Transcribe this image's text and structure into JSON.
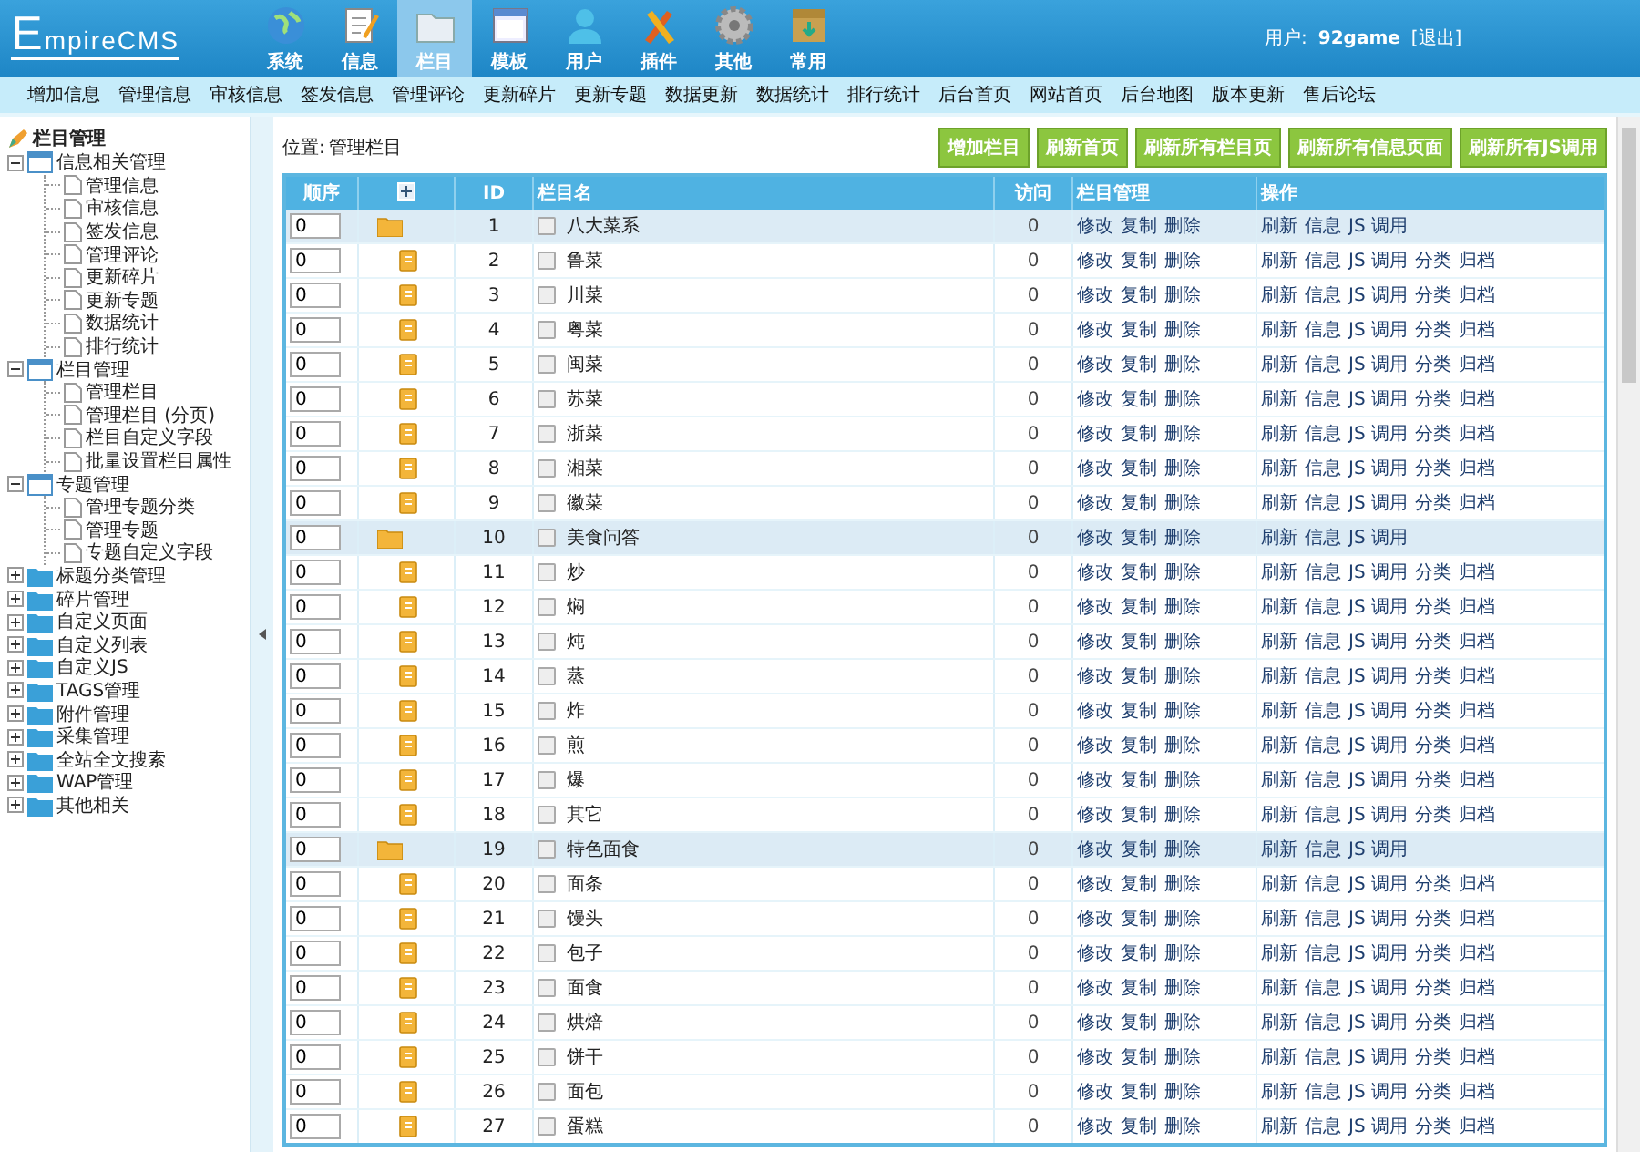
{
  "header": {
    "logo": "EmpireCMS",
    "nav": [
      {
        "label": "系统",
        "selected": false
      },
      {
        "label": "信息",
        "selected": false
      },
      {
        "label": "栏目",
        "selected": true
      },
      {
        "label": "模板",
        "selected": false
      },
      {
        "label": "用户",
        "selected": false
      },
      {
        "label": "插件",
        "selected": false
      },
      {
        "label": "其他",
        "selected": false
      },
      {
        "label": "常用",
        "selected": false
      }
    ],
    "user_label": "用户:",
    "user_name": "92game",
    "logout": "[退出]"
  },
  "menu": [
    "增加信息",
    "管理信息",
    "审核信息",
    "签发信息",
    "管理评论",
    "更新碎片",
    "更新专题",
    "数据更新",
    "数据统计",
    "排行统计",
    "后台首页",
    "网站首页",
    "后台地图",
    "版本更新",
    "售后论坛"
  ],
  "sidebar": {
    "title": "栏目管理",
    "groups": [
      {
        "label": "信息相关管理",
        "expanded": true,
        "children": [
          "管理信息",
          "审核信息",
          "签发信息",
          "管理评论",
          "更新碎片",
          "更新专题",
          "数据统计",
          "排行统计"
        ]
      },
      {
        "label": "栏目管理",
        "expanded": true,
        "children": [
          "管理栏目",
          "管理栏目 (分页)",
          "栏目自定义字段",
          "批量设置栏目属性"
        ]
      },
      {
        "label": "专题管理",
        "expanded": true,
        "children": [
          "管理专题分类",
          "管理专题",
          "专题自定义字段"
        ]
      },
      {
        "label": "标题分类管理",
        "expanded": false
      },
      {
        "label": "碎片管理",
        "expanded": false
      },
      {
        "label": "自定义页面",
        "expanded": false
      },
      {
        "label": "自定义列表",
        "expanded": false
      },
      {
        "label": "自定义JS",
        "expanded": false
      },
      {
        "label": "TAGS管理",
        "expanded": false
      },
      {
        "label": "附件管理",
        "expanded": false
      },
      {
        "label": "采集管理",
        "expanded": false
      },
      {
        "label": "全站全文搜索",
        "expanded": false
      },
      {
        "label": "WAP管理",
        "expanded": false
      },
      {
        "label": "其他相关",
        "expanded": false
      }
    ]
  },
  "location": {
    "label": "位置:",
    "value": "管理栏目"
  },
  "buttons": [
    "增加栏目",
    "刷新首页",
    "刷新所有栏目页",
    "刷新所有信息页面",
    "刷新所有JS调用"
  ],
  "table": {
    "columns": [
      "顺序",
      "",
      "ID",
      "栏目名",
      "访问",
      "栏目管理",
      "操作"
    ],
    "rows": [
      {
        "order": "0",
        "kind": "parent",
        "id": "1",
        "name": "八大菜系",
        "checked": false,
        "visits": "0",
        "manage": [
          "修改",
          "复制",
          "删除"
        ],
        "actions": [
          "刷新",
          "信息",
          "JS 调用"
        ]
      },
      {
        "order": "0",
        "kind": "child",
        "id": "2",
        "name": "鲁菜",
        "checked": false,
        "visits": "0",
        "manage": [
          "修改",
          "复制",
          "删除"
        ],
        "actions": [
          "刷新",
          "信息",
          "JS 调用",
          "分类",
          "归档"
        ]
      },
      {
        "order": "0",
        "kind": "child",
        "id": "3",
        "name": "川菜",
        "checked": false,
        "visits": "0",
        "manage": [
          "修改",
          "复制",
          "删除"
        ],
        "actions": [
          "刷新",
          "信息",
          "JS 调用",
          "分类",
          "归档"
        ]
      },
      {
        "order": "0",
        "kind": "child",
        "id": "4",
        "name": "粤菜",
        "checked": false,
        "visits": "0",
        "manage": [
          "修改",
          "复制",
          "删除"
        ],
        "actions": [
          "刷新",
          "信息",
          "JS 调用",
          "分类",
          "归档"
        ]
      },
      {
        "order": "0",
        "kind": "child",
        "id": "5",
        "name": "闽菜",
        "checked": false,
        "visits": "0",
        "manage": [
          "修改",
          "复制",
          "删除"
        ],
        "actions": [
          "刷新",
          "信息",
          "JS 调用",
          "分类",
          "归档"
        ]
      },
      {
        "order": "0",
        "kind": "child",
        "id": "6",
        "name": "苏菜",
        "checked": false,
        "visits": "0",
        "manage": [
          "修改",
          "复制",
          "删除"
        ],
        "actions": [
          "刷新",
          "信息",
          "JS 调用",
          "分类",
          "归档"
        ]
      },
      {
        "order": "0",
        "kind": "child",
        "id": "7",
        "name": "浙菜",
        "checked": false,
        "visits": "0",
        "manage": [
          "修改",
          "复制",
          "删除"
        ],
        "actions": [
          "刷新",
          "信息",
          "JS 调用",
          "分类",
          "归档"
        ]
      },
      {
        "order": "0",
        "kind": "child",
        "id": "8",
        "name": "湘菜",
        "checked": false,
        "visits": "0",
        "manage": [
          "修改",
          "复制",
          "删除"
        ],
        "actions": [
          "刷新",
          "信息",
          "JS 调用",
          "分类",
          "归档"
        ]
      },
      {
        "order": "0",
        "kind": "child",
        "id": "9",
        "name": "徽菜",
        "checked": false,
        "visits": "0",
        "manage": [
          "修改",
          "复制",
          "删除"
        ],
        "actions": [
          "刷新",
          "信息",
          "JS 调用",
          "分类",
          "归档"
        ]
      },
      {
        "order": "0",
        "kind": "parent",
        "id": "10",
        "name": "美食问答",
        "checked": false,
        "visits": "0",
        "manage": [
          "修改",
          "复制",
          "删除"
        ],
        "actions": [
          "刷新",
          "信息",
          "JS 调用"
        ]
      },
      {
        "order": "0",
        "kind": "child",
        "id": "11",
        "name": "炒",
        "checked": false,
        "visits": "0",
        "manage": [
          "修改",
          "复制",
          "删除"
        ],
        "actions": [
          "刷新",
          "信息",
          "JS 调用",
          "分类",
          "归档"
        ]
      },
      {
        "order": "0",
        "kind": "child",
        "id": "12",
        "name": "焖",
        "checked": false,
        "visits": "0",
        "manage": [
          "修改",
          "复制",
          "删除"
        ],
        "actions": [
          "刷新",
          "信息",
          "JS 调用",
          "分类",
          "归档"
        ]
      },
      {
        "order": "0",
        "kind": "child",
        "id": "13",
        "name": "炖",
        "checked": false,
        "visits": "0",
        "manage": [
          "修改",
          "复制",
          "删除"
        ],
        "actions": [
          "刷新",
          "信息",
          "JS 调用",
          "分类",
          "归档"
        ]
      },
      {
        "order": "0",
        "kind": "child",
        "id": "14",
        "name": "蒸",
        "checked": false,
        "visits": "0",
        "manage": [
          "修改",
          "复制",
          "删除"
        ],
        "actions": [
          "刷新",
          "信息",
          "JS 调用",
          "分类",
          "归档"
        ]
      },
      {
        "order": "0",
        "kind": "child",
        "id": "15",
        "name": "炸",
        "checked": false,
        "visits": "0",
        "manage": [
          "修改",
          "复制",
          "删除"
        ],
        "actions": [
          "刷新",
          "信息",
          "JS 调用",
          "分类",
          "归档"
        ]
      },
      {
        "order": "0",
        "kind": "child",
        "id": "16",
        "name": "煎",
        "checked": false,
        "visits": "0",
        "manage": [
          "修改",
          "复制",
          "删除"
        ],
        "actions": [
          "刷新",
          "信息",
          "JS 调用",
          "分类",
          "归档"
        ]
      },
      {
        "order": "0",
        "kind": "child",
        "id": "17",
        "name": "爆",
        "checked": false,
        "visits": "0",
        "manage": [
          "修改",
          "复制",
          "删除"
        ],
        "actions": [
          "刷新",
          "信息",
          "JS 调用",
          "分类",
          "归档"
        ]
      },
      {
        "order": "0",
        "kind": "child",
        "id": "18",
        "name": "其它",
        "checked": false,
        "visits": "0",
        "manage": [
          "修改",
          "复制",
          "删除"
        ],
        "actions": [
          "刷新",
          "信息",
          "JS 调用",
          "分类",
          "归档"
        ]
      },
      {
        "order": "0",
        "kind": "parent",
        "id": "19",
        "name": "特色面食",
        "checked": false,
        "visits": "0",
        "manage": [
          "修改",
          "复制",
          "删除"
        ],
        "actions": [
          "刷新",
          "信息",
          "JS 调用"
        ]
      },
      {
        "order": "0",
        "kind": "child",
        "id": "20",
        "name": "面条",
        "checked": false,
        "visits": "0",
        "manage": [
          "修改",
          "复制",
          "删除"
        ],
        "actions": [
          "刷新",
          "信息",
          "JS 调用",
          "分类",
          "归档"
        ]
      },
      {
        "order": "0",
        "kind": "child",
        "id": "21",
        "name": "馒头",
        "checked": false,
        "visits": "0",
        "manage": [
          "修改",
          "复制",
          "删除"
        ],
        "actions": [
          "刷新",
          "信息",
          "JS 调用",
          "分类",
          "归档"
        ]
      },
      {
        "order": "0",
        "kind": "child",
        "id": "22",
        "name": "包子",
        "checked": false,
        "visits": "0",
        "manage": [
          "修改",
          "复制",
          "删除"
        ],
        "actions": [
          "刷新",
          "信息",
          "JS 调用",
          "分类",
          "归档"
        ]
      },
      {
        "order": "0",
        "kind": "child",
        "id": "23",
        "name": "面食",
        "checked": false,
        "visits": "0",
        "manage": [
          "修改",
          "复制",
          "删除"
        ],
        "actions": [
          "刷新",
          "信息",
          "JS 调用",
          "分类",
          "归档"
        ]
      },
      {
        "order": "0",
        "kind": "child",
        "id": "24",
        "name": "烘焙",
        "checked": false,
        "visits": "0",
        "manage": [
          "修改",
          "复制",
          "删除"
        ],
        "actions": [
          "刷新",
          "信息",
          "JS 调用",
          "分类",
          "归档"
        ]
      },
      {
        "order": "0",
        "kind": "child",
        "id": "25",
        "name": "饼干",
        "checked": false,
        "visits": "0",
        "manage": [
          "修改",
          "复制",
          "删除"
        ],
        "actions": [
          "刷新",
          "信息",
          "JS 调用",
          "分类",
          "归档"
        ]
      },
      {
        "order": "0",
        "kind": "child",
        "id": "26",
        "name": "面包",
        "checked": false,
        "visits": "0",
        "manage": [
          "修改",
          "复制",
          "删除"
        ],
        "actions": [
          "刷新",
          "信息",
          "JS 调用",
          "分类",
          "归档"
        ]
      },
      {
        "order": "0",
        "kind": "child",
        "id": "27",
        "name": "蛋糕",
        "checked": false,
        "visits": "0",
        "manage": [
          "修改",
          "复制",
          "删除"
        ],
        "actions": [
          "刷新",
          "信息",
          "JS 调用",
          "分类",
          "归档"
        ]
      }
    ]
  }
}
